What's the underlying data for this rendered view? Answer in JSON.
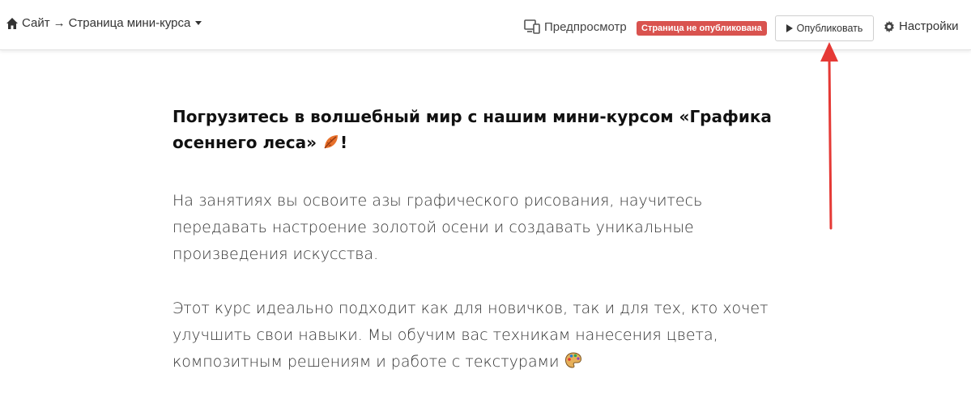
{
  "topbar": {
    "breadcrumb": {
      "site": "Сайт",
      "separator": "→",
      "page": "Страница мини-курса"
    },
    "preview_label": "Предпросмотр",
    "status_badge": "Страница не опубликована",
    "publish_label": "Опубликовать",
    "settings_label": "Настройки"
  },
  "content": {
    "headline": "Погрузитесь в волшебный мир с нашим мини-курсом «Графика осеннего леса»",
    "headline_end": "!",
    "paragraph1": "На занятиях вы освоите азы графического рисования, научитесь передавать настроение золотой осени и создавать уникальные произведения искусства.",
    "paragraph2": "Этот курс идеально подходит как для новичков, так и для тех, кто хочет улучшить свои навыки. Мы обучим вас техникам нанесения цвета, композитным решениям и работе с текстурами"
  },
  "icons": {
    "home": "home-icon",
    "caret": "caret-down-icon",
    "preview": "devices-icon",
    "play": "play-icon",
    "settings": "gear-icon",
    "leaf": "fallen-leaf-icon",
    "palette": "palette-icon"
  },
  "colors": {
    "badge_bg": "#d9534f",
    "annotation_arrow": "#e53935"
  }
}
